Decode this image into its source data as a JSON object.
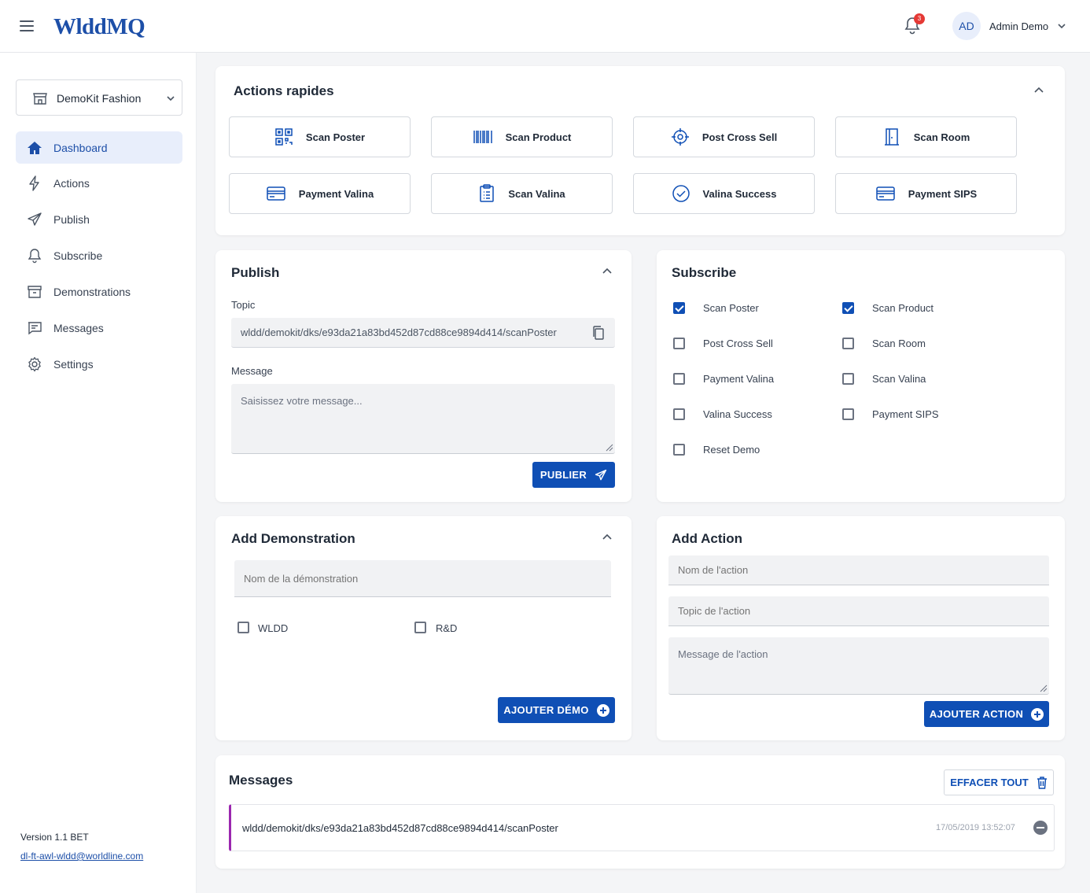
{
  "header": {
    "logo": "WlddMQ",
    "notification_count": "3",
    "avatar_initials": "AD",
    "user_name": "Admin Demo"
  },
  "sidebar": {
    "store": "DemoKit Fashion",
    "items": [
      {
        "label": "Dashboard",
        "icon": "home-icon",
        "active": true
      },
      {
        "label": "Actions",
        "icon": "bolt-icon"
      },
      {
        "label": "Publish",
        "icon": "send-icon"
      },
      {
        "label": "Subscribe",
        "icon": "bell-icon"
      },
      {
        "label": "Demonstrations",
        "icon": "archive-icon"
      },
      {
        "label": "Messages",
        "icon": "chat-icon"
      },
      {
        "label": "Settings",
        "icon": "gear-icon"
      }
    ],
    "version": "Version 1.1 BET",
    "email": "dl-ft-awl-wldd@worldline.com"
  },
  "quick_actions": {
    "title": "Actions rapides",
    "buttons": [
      {
        "label": "Scan Poster",
        "icon": "qr-code-icon"
      },
      {
        "label": "Scan Product",
        "icon": "barcode-icon"
      },
      {
        "label": "Post Cross Sell",
        "icon": "target-icon"
      },
      {
        "label": "Scan Room",
        "icon": "door-icon"
      },
      {
        "label": "Payment Valina",
        "icon": "credit-card-icon"
      },
      {
        "label": "Scan Valina",
        "icon": "clipboard-icon"
      },
      {
        "label": "Valina Success",
        "icon": "check-circle-icon"
      },
      {
        "label": "Payment SIPS",
        "icon": "credit-card-icon"
      }
    ]
  },
  "publish": {
    "title": "Publish",
    "topic_label": "Topic",
    "topic_value": "wldd/demokit/dks/e93da21a83bd452d87cd88ce9894d414/scanPoster",
    "message_label": "Message",
    "message_placeholder": "Saisissez votre message...",
    "submit_label": "PUBLIER"
  },
  "subscribe": {
    "title": "Subscribe",
    "options": [
      {
        "label": "Scan Poster",
        "checked": true
      },
      {
        "label": "Scan Product",
        "checked": true
      },
      {
        "label": "Post Cross Sell",
        "checked": false
      },
      {
        "label": "Scan Room",
        "checked": false
      },
      {
        "label": "Payment Valina",
        "checked": false
      },
      {
        "label": "Scan Valina",
        "checked": false
      },
      {
        "label": "Valina Success",
        "checked": false
      },
      {
        "label": "Payment SIPS",
        "checked": false
      },
      {
        "label": "Reset Demo",
        "checked": false
      }
    ]
  },
  "add_demo": {
    "title": "Add Demonstration",
    "name_placeholder": "Nom de la démonstration",
    "options": [
      {
        "label": "WLDD",
        "checked": false
      },
      {
        "label": "R&D",
        "checked": false
      }
    ],
    "submit_label": "AJOUTER DÉMO"
  },
  "add_action": {
    "title": "Add Action",
    "name_placeholder": "Nom de l'action",
    "topic_placeholder": "Topic de l'action",
    "message_placeholder": "Message de l'action",
    "submit_label": "AJOUTER ACTION"
  },
  "messages": {
    "title": "Messages",
    "clear_label": "EFFACER TOUT",
    "items": [
      {
        "topic": "wldd/demokit/dks/e93da21a83bd452d87cd88ce9894d414/scanPoster",
        "timestamp": "17/05/2019 13:52:07"
      }
    ]
  },
  "colors": {
    "primary": "#0f4fb5",
    "logo": "#1d4fa8",
    "message_accent": "#9b27af",
    "badge": "#e53935"
  }
}
